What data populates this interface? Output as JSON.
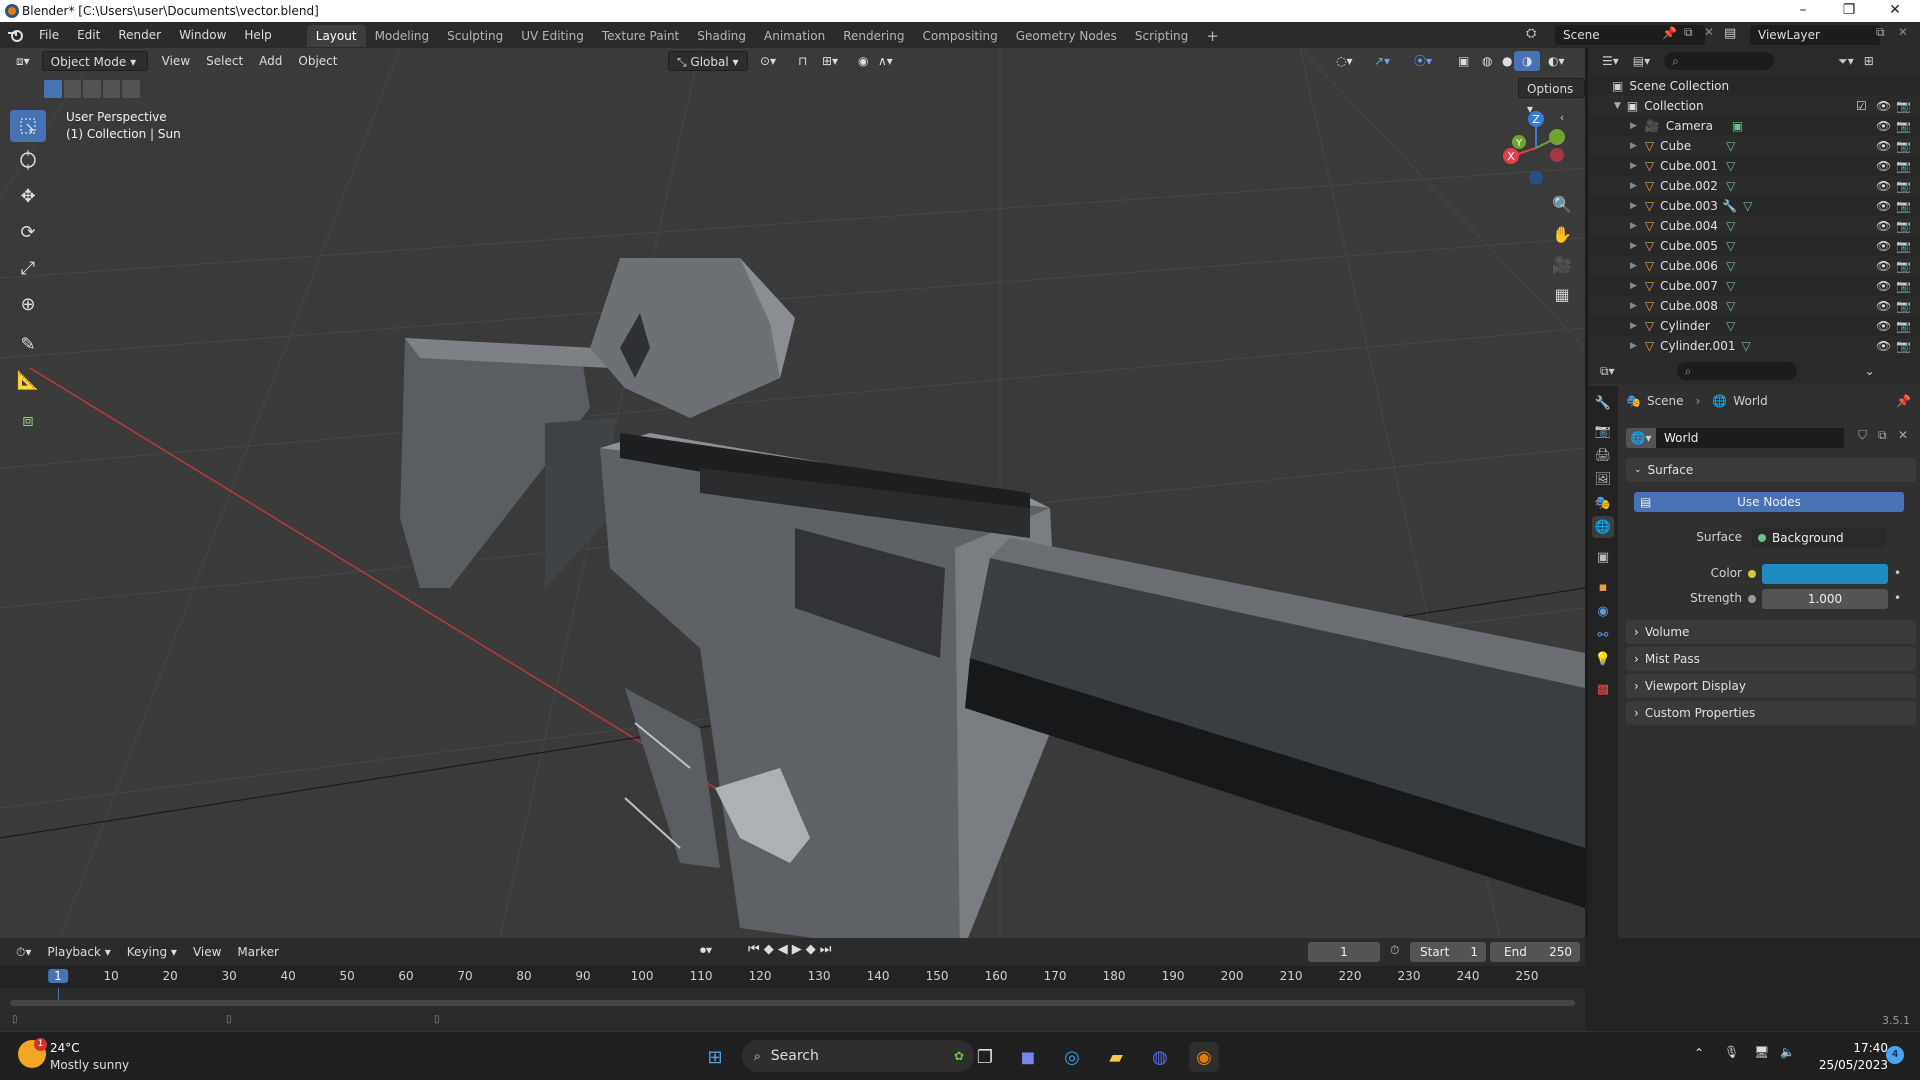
{
  "window": {
    "title": "Blender* [C:\\Users\\user\\Documents\\vector.blend]",
    "minimize": "–",
    "maximize": "❐",
    "close": "✕"
  },
  "menu": [
    "File",
    "Edit",
    "Render",
    "Window",
    "Help"
  ],
  "workspaces": [
    "Layout",
    "Modeling",
    "Sculpting",
    "UV Editing",
    "Texture Paint",
    "Shading",
    "Animation",
    "Rendering",
    "Compositing",
    "Geometry Nodes",
    "Scripting"
  ],
  "workspace_add": "+",
  "scene_name": "Scene",
  "view_layer": "ViewLayer",
  "viewport": {
    "mode": "Object Mode",
    "menus": [
      "View",
      "Select",
      "Add",
      "Object"
    ],
    "transform_orientation": "Global",
    "options_label": "Options",
    "perspective": "User Perspective",
    "collection_info": "(1) Collection | Sun",
    "gizmo_axes": {
      "z": "Z",
      "y": "Y",
      "x": "X"
    }
  },
  "outliner": {
    "scene_collection": "Scene Collection",
    "collection": "Collection",
    "items": [
      {
        "name": "Camera",
        "type": "camera"
      },
      {
        "name": "Cube",
        "type": "mesh"
      },
      {
        "name": "Cube.001",
        "type": "mesh"
      },
      {
        "name": "Cube.002",
        "type": "mesh"
      },
      {
        "name": "Cube.003",
        "type": "mesh",
        "modifier": true
      },
      {
        "name": "Cube.004",
        "type": "mesh"
      },
      {
        "name": "Cube.005",
        "type": "mesh"
      },
      {
        "name": "Cube.006",
        "type": "mesh"
      },
      {
        "name": "Cube.007",
        "type": "mesh"
      },
      {
        "name": "Cube.008",
        "type": "mesh"
      },
      {
        "name": "Cylinder",
        "type": "mesh"
      },
      {
        "name": "Cylinder.001",
        "type": "mesh"
      }
    ]
  },
  "properties": {
    "breadcrumb_scene": "Scene",
    "breadcrumb_world": "World",
    "datablock": "World",
    "surface_panel": "Surface",
    "use_nodes": "Use Nodes",
    "surface_label": "Surface",
    "surface_value": "Background",
    "color_label": "Color",
    "color_value": "#1e8bc3",
    "strength_label": "Strength",
    "strength_value": "1.000",
    "panels": [
      "Volume",
      "Mist Pass",
      "Viewport Display",
      "Custom Properties"
    ]
  },
  "timeline": {
    "menus": [
      "Playback",
      "Keying",
      "View",
      "Marker"
    ],
    "current_frame": "1",
    "start_label": "Start",
    "start_value": "1",
    "end_label": "End",
    "end_value": "250",
    "ticks": [
      "1",
      "10",
      "20",
      "30",
      "40",
      "50",
      "60",
      "70",
      "80",
      "90",
      "100",
      "110",
      "120",
      "130",
      "140",
      "150",
      "160",
      "170",
      "180",
      "190",
      "200",
      "210",
      "220",
      "230",
      "240",
      "250"
    ]
  },
  "version": "3.5.1",
  "taskbar": {
    "weather_temp": "24°C",
    "weather_desc": "Mostly sunny",
    "search": "Search",
    "time": "17:40",
    "date": "25/05/2023",
    "notif_count": "4",
    "weather_badge": "1"
  },
  "colors": {
    "accent": "#4772b3",
    "world_color": "#1e8bc3",
    "axis_x": "#e04050",
    "axis_y": "#6ea52f",
    "axis_z": "#3a7bd5"
  }
}
